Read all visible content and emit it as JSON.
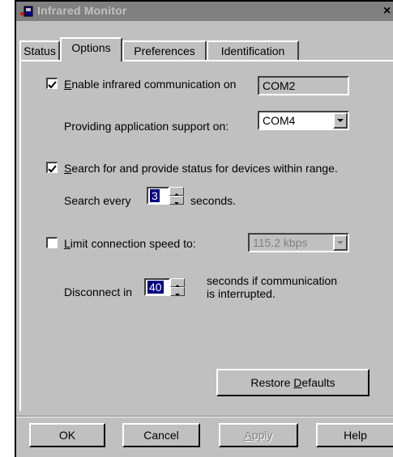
{
  "window": {
    "title": "Infrared Monitor",
    "close_glyph": "×",
    "icon": "infrared-app-icon"
  },
  "tabs": [
    {
      "label": "Status",
      "active": false
    },
    {
      "label": "Options",
      "active": true
    },
    {
      "label": "Preferences",
      "active": false
    },
    {
      "label": "Identification",
      "active": false
    }
  ],
  "options": {
    "enable_ir": {
      "prefix": "",
      "accel": "E",
      "rest": "nable infrared communication on",
      "checked": true,
      "port": "COM2"
    },
    "app_support": {
      "label": "Providing application support on:",
      "value": "COM4"
    },
    "search": {
      "accel": "S",
      "rest": "earch for and provide status for devices within range.",
      "checked": true
    },
    "search_every": {
      "label": "Search every",
      "value": "3",
      "suffix": "seconds."
    },
    "limit_speed": {
      "accel": "L",
      "rest": "imit connection speed to:",
      "checked": false,
      "value": "115.2 kbps"
    },
    "disconnect": {
      "label": "Disconnect in",
      "value": "40",
      "suffix_line1": "seconds if communication",
      "suffix_line2": "is interrupted."
    },
    "restore": {
      "pre": "Restore ",
      "accel": "D",
      "post": "efaults"
    }
  },
  "buttons": {
    "ok": "OK",
    "cancel": "Cancel",
    "apply_accel": "A",
    "apply_rest": "pply",
    "help": "Help"
  },
  "colors": {
    "selection": "#000080",
    "face": "#c0c0c0",
    "titlebar_inactive": "#808080",
    "disabled_text": "#808080"
  }
}
